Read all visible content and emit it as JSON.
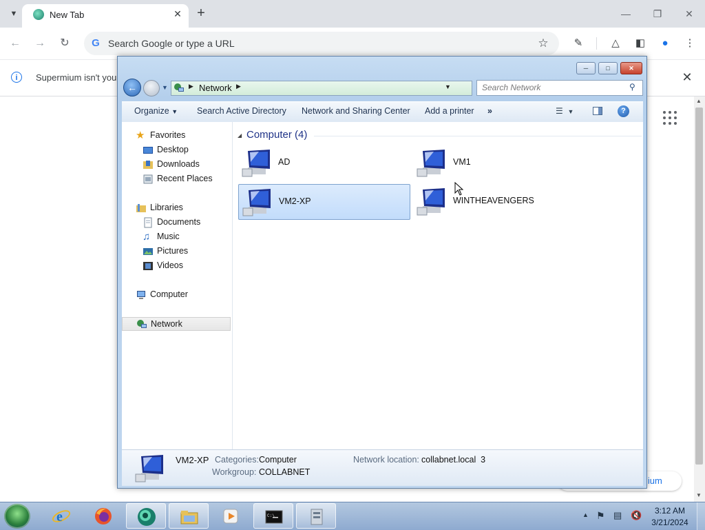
{
  "browser": {
    "tab_title": "New Tab",
    "omnibox_placeholder": "Search Google or type a URL",
    "infobar_text": "Supermium isn't you",
    "customize_text": "mium"
  },
  "explorer": {
    "breadcrumb": "Network",
    "search_placeholder": "Search Network",
    "toolbar": {
      "organize": "Organize",
      "search_ad": "Search Active Directory",
      "network_sharing": "Network and Sharing Center",
      "add_printer": "Add a printer",
      "more": "»"
    },
    "nav": {
      "favorites": "Favorites",
      "desktop": "Desktop",
      "downloads": "Downloads",
      "recent_places": "Recent Places",
      "libraries": "Libraries",
      "documents": "Documents",
      "music": "Music",
      "pictures": "Pictures",
      "videos": "Videos",
      "computer": "Computer",
      "network": "Network"
    },
    "group_header": "Computer (4)",
    "computers": [
      {
        "name": "AD",
        "selected": false
      },
      {
        "name": "VM1",
        "selected": false
      },
      {
        "name": "VM2-XP",
        "selected": true
      },
      {
        "name": "WINTHEAVENGERS",
        "selected": false
      }
    ],
    "details": {
      "name": "VM2-XP",
      "categories_label": "Categories:",
      "categories_value": "Computer",
      "workgroup_label": "Workgroup:",
      "workgroup_value": "COLLABNET",
      "network_location_label": "Network location:",
      "network_location_value": "collabnet.local  3"
    }
  },
  "taskbar": {
    "time": "3:12 AM",
    "date": "3/21/2024",
    "buttons": [
      "internet-explorer",
      "firefox",
      "supermium",
      "windows-explorer",
      "media-player",
      "command-prompt",
      "network-tool"
    ]
  }
}
